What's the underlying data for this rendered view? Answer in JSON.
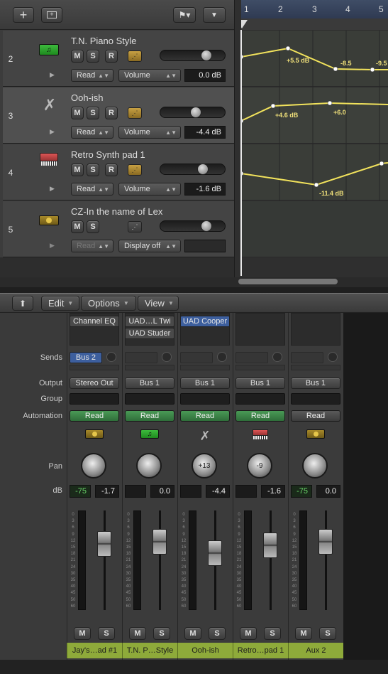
{
  "toolbar": {
    "add_icon": "plus-icon",
    "dup_icon": "duplicate-track-icon",
    "flag_icon": "flag-menu-icon",
    "collapse_icon": "chevron-down-icon"
  },
  "ruler": {
    "bars": [
      "1",
      "2",
      "3",
      "4",
      "5"
    ]
  },
  "tracks": [
    {
      "number": "2",
      "name": "T.N. Piano Style",
      "icon": "keyboard-midi-icon",
      "m": "M",
      "s": "S",
      "r": "R",
      "automation_mode": "Read",
      "parameter": "Volume",
      "value": "0.0 dB"
    },
    {
      "number": "3",
      "name": "Ooh-ish",
      "icon": "x-stand-icon",
      "m": "M",
      "s": "S",
      "r": "R",
      "automation_mode": "Read",
      "parameter": "Volume",
      "value": "-4.4 dB"
    },
    {
      "number": "4",
      "name": "Retro Synth pad 1",
      "icon": "synth-icon",
      "m": "M",
      "s": "S",
      "r": "R",
      "automation_mode": "Read",
      "parameter": "Volume",
      "value": "-1.6 dB"
    },
    {
      "number": "5",
      "name": "CZ-In the name of Lex",
      "icon": "aux-icon",
      "m": "M",
      "s": "S",
      "automation_mode": "Read",
      "parameter": "Display off",
      "value": ""
    }
  ],
  "automation_labels": {
    "t2": [
      "+5.5 dB",
      "-8.5",
      "-9.5"
    ],
    "t3": [
      "+4.6 dB",
      "+6.0"
    ],
    "t4": [
      "-11.4 dB"
    ]
  },
  "mixer_menu": {
    "up_icon": "arrow-up-icon",
    "edit": "Edit",
    "options": "Options",
    "view": "View"
  },
  "row_labels": {
    "sends": "Sends",
    "output": "Output",
    "group": "Group",
    "automation": "Automation",
    "pan": "Pan",
    "db": "dB"
  },
  "strips": [
    {
      "inserts": [
        "Channel EQ"
      ],
      "send": "Bus 2",
      "output": "Stereo Out",
      "automation": "Read",
      "auto_on": true,
      "pan": "",
      "db_left": "-75",
      "db_right": "-1.7",
      "m": "M",
      "s": "S",
      "name": "Jay's…ad #1",
      "icon": "aux-icon",
      "fader": 0.72
    },
    {
      "inserts": [
        "UAD…L Twi",
        "UAD Studer"
      ],
      "send": "",
      "output": "Bus 1",
      "automation": "Read",
      "auto_on": true,
      "pan": "",
      "db_left": "",
      "db_right": "0.0",
      "m": "M",
      "s": "S",
      "name": "T.N. P…Style",
      "icon": "keyboard-midi-icon",
      "fader": 0.75
    },
    {
      "inserts": [
        "UAD Cooper"
      ],
      "send": "",
      "output": "Bus 1",
      "automation": "Read",
      "auto_on": true,
      "pan": "+13",
      "db_left": "",
      "db_right": "-4.4",
      "m": "M",
      "s": "S",
      "name": "Ooh-ish",
      "icon": "x-stand-icon",
      "fader": 0.6
    },
    {
      "inserts": [],
      "send": "",
      "output": "Bus 1",
      "automation": "Read",
      "auto_on": true,
      "pan": "-9",
      "db_left": "",
      "db_right": "-1.6",
      "m": "M",
      "s": "S",
      "name": "Retro…pad 1",
      "icon": "synth-icon",
      "fader": 0.7
    },
    {
      "inserts": [],
      "send": "",
      "output": "Bus 1",
      "automation": "Read",
      "auto_on": false,
      "pan": "",
      "db_left": "-75",
      "db_right": "0.0",
      "m": "M",
      "s": "S",
      "name": "Aux 2",
      "icon": "aux-icon",
      "fader": 0.75
    }
  ],
  "meter_scale": [
    "0",
    "3",
    "6",
    "9",
    "12",
    "15",
    "18",
    "21",
    "24",
    "30",
    "35",
    "40",
    "45",
    "50",
    "60"
  ],
  "colors": {
    "automation_line": "#f2e35c",
    "track_name_bar": "#8eaa3a",
    "read_green": "#3f8a4a",
    "send_blue": "#3d5f9e"
  }
}
